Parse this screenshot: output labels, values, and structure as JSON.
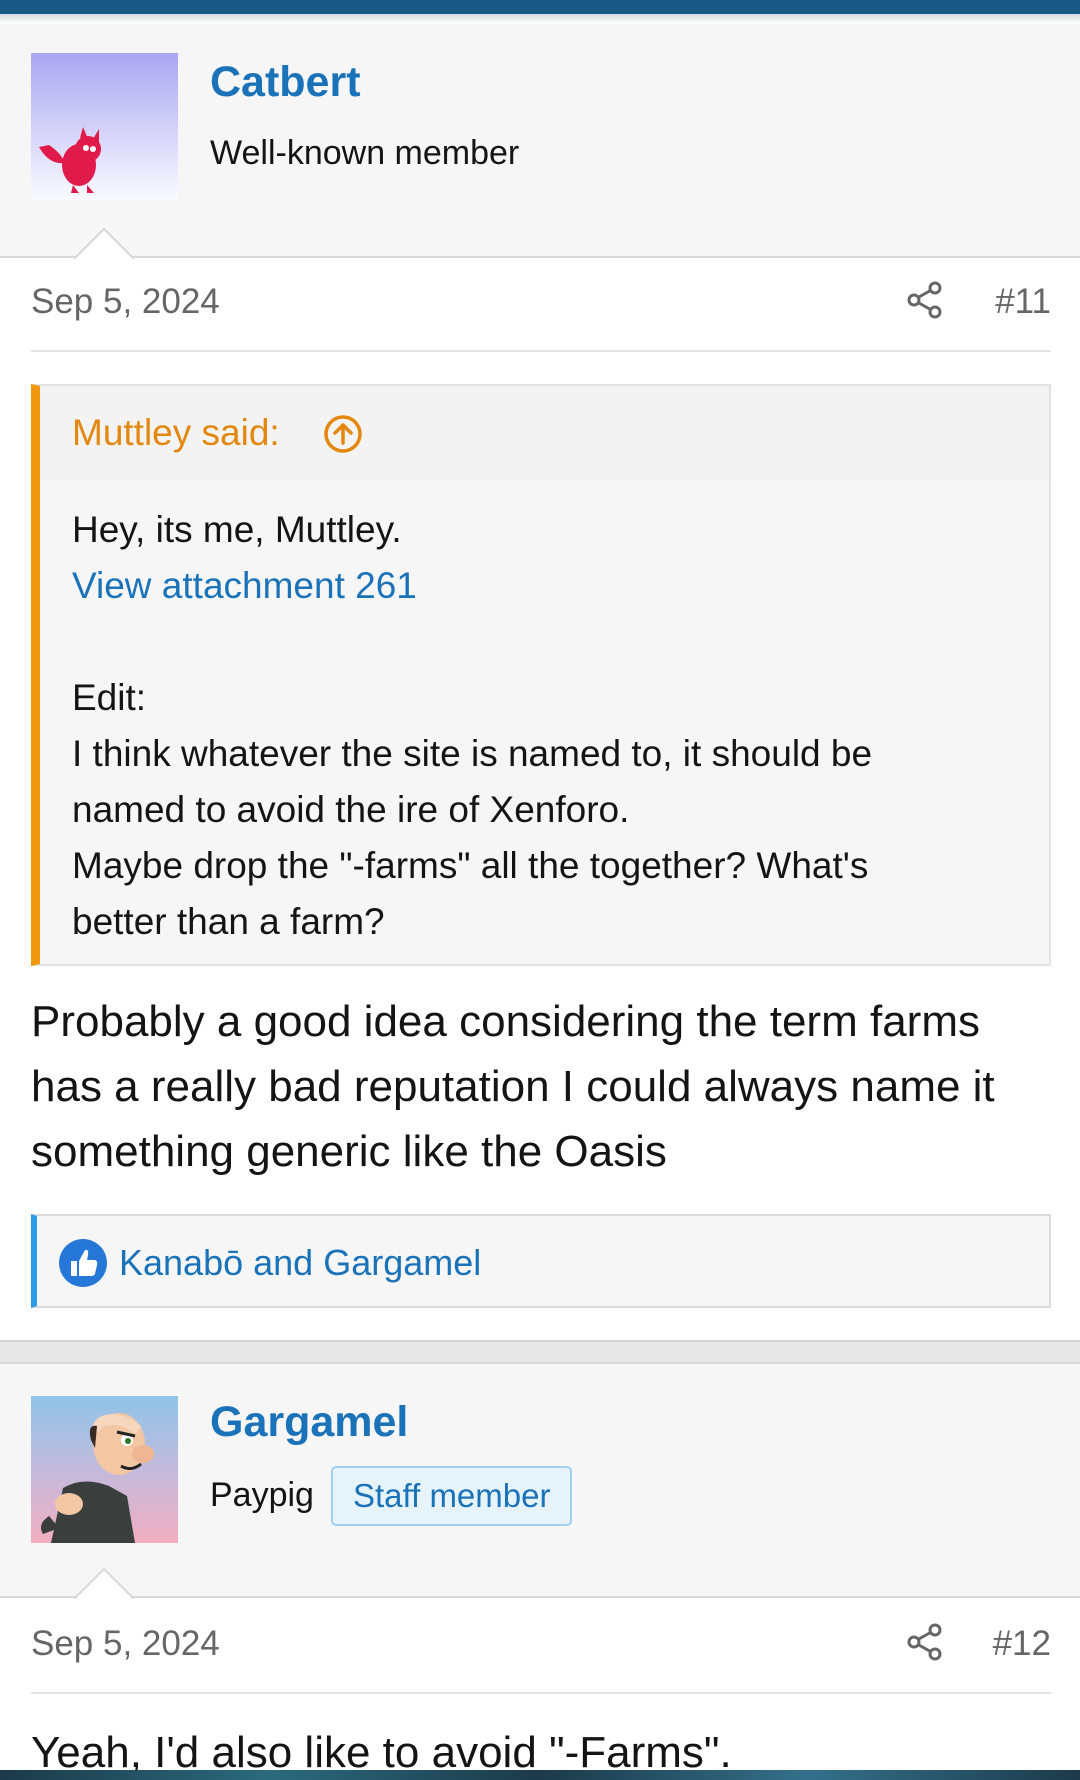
{
  "posts": [
    {
      "username": "Catbert",
      "user_title": "Well-known member",
      "date": "Sep 5, 2024",
      "post_number": "#11",
      "quote": {
        "author": "Muttley said:",
        "line1": "Hey, its me, Muttley.",
        "attachment_link": "View attachment 261",
        "line3": "Edit:",
        "line4": "I think whatever the site is named to, it should be",
        "line5": "named to avoid the ire of Xenforo.",
        "line6": "Maybe drop the \"-farms\" all the together? What's",
        "line7": "better than a farm?"
      },
      "body": "Probably a good idea considering the term farms has a really bad reputation I could always name it something generic like the Oasis",
      "reactions": "Kanabō and Gargamel"
    },
    {
      "username": "Gargamel",
      "user_title": "Paypig",
      "badge": "Staff member",
      "date": "Sep 5, 2024",
      "post_number": "#12",
      "body": "Yeah, I'd also like to avoid \"-Farms\"."
    }
  ],
  "icons": {
    "share": "share-icon",
    "quote_jump": "arrow-up-circle-icon",
    "like": "thumbs-up-icon"
  },
  "colors": {
    "topbar": "#185886",
    "link": "#1a72b8",
    "quote_accent": "#f0960f",
    "reaction_accent": "#2f9be0"
  }
}
